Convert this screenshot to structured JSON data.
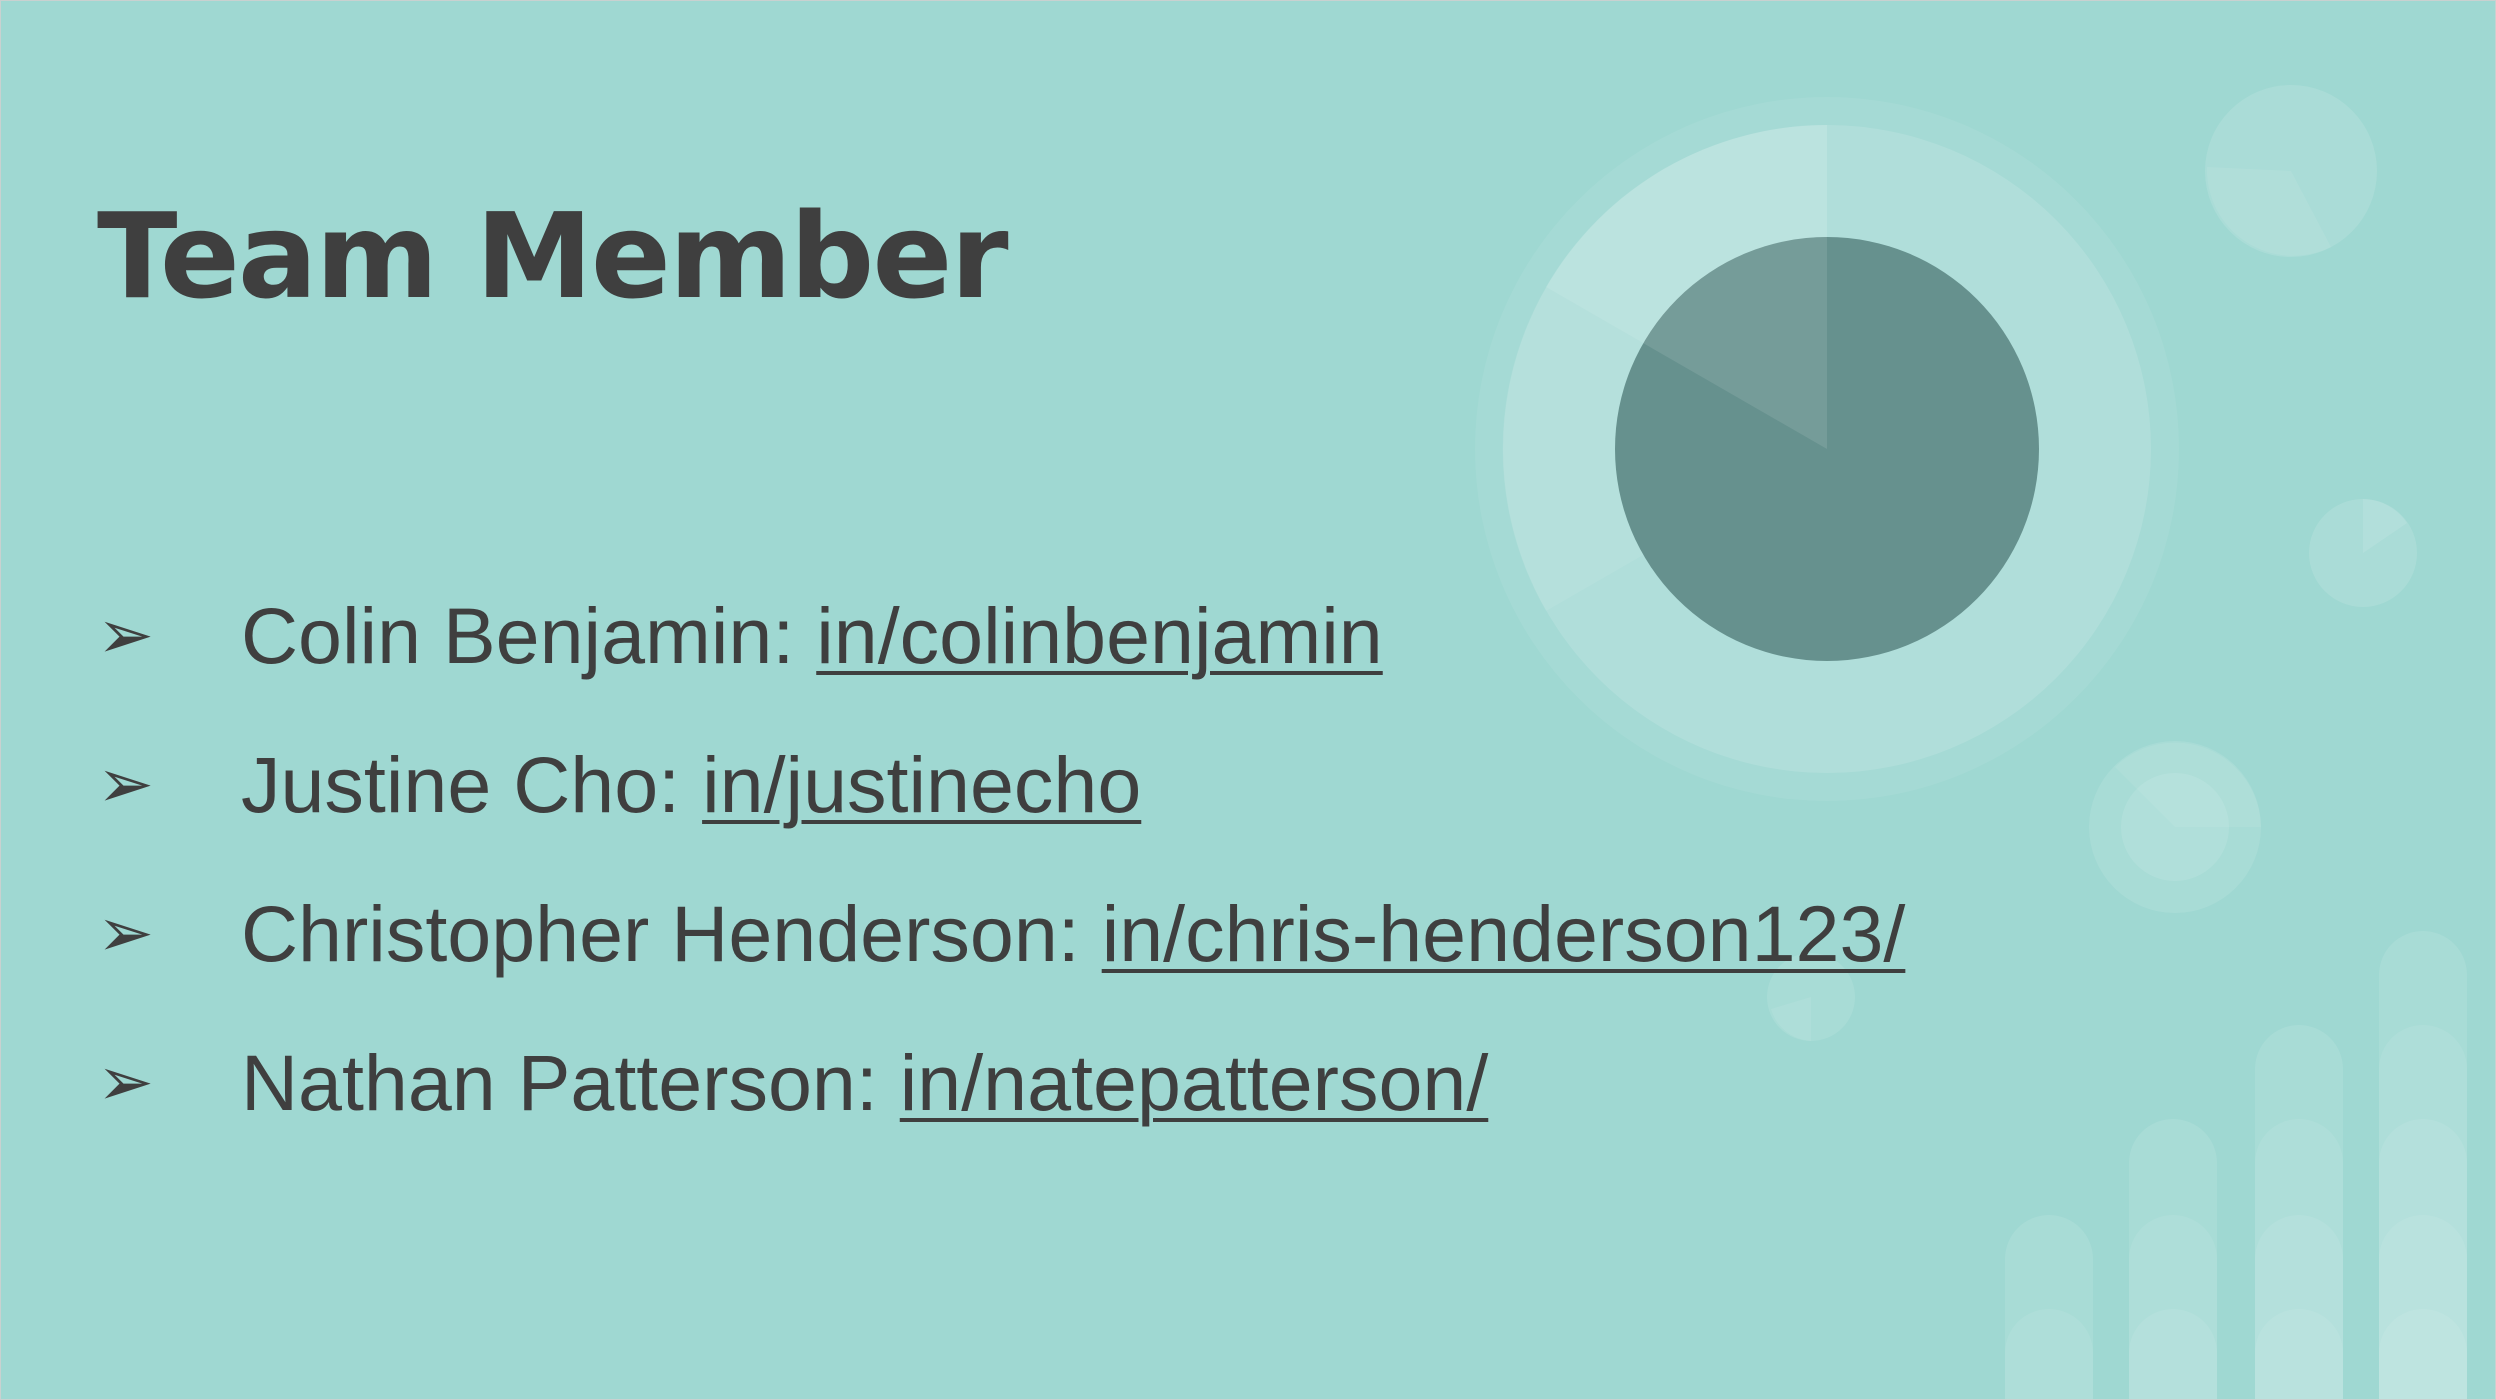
{
  "slide": {
    "title": "Team Member",
    "bullet_glyph": "➢",
    "members": [
      {
        "name": "Colin Benjamin:",
        "link": "in/colinbenjamin"
      },
      {
        "name": "Justine Cho:",
        "link": "in/justinecho"
      },
      {
        "name": "Christopher Henderson:",
        "link": "in/chris-henderson123/"
      },
      {
        "name": "Nathan Patterson:",
        "link": "in/natepatterson/"
      }
    ]
  },
  "colors": {
    "background": "#9fd8d2",
    "text": "#3f3f3f",
    "pie_dark": "#66918e",
    "spell_check_underline": "#d9534f"
  },
  "icons": {
    "bullet": "arrowhead-bullet-icon",
    "decoration": [
      "pie-chart-graphic",
      "small-pie-icons",
      "bar-column-graphic"
    ]
  }
}
